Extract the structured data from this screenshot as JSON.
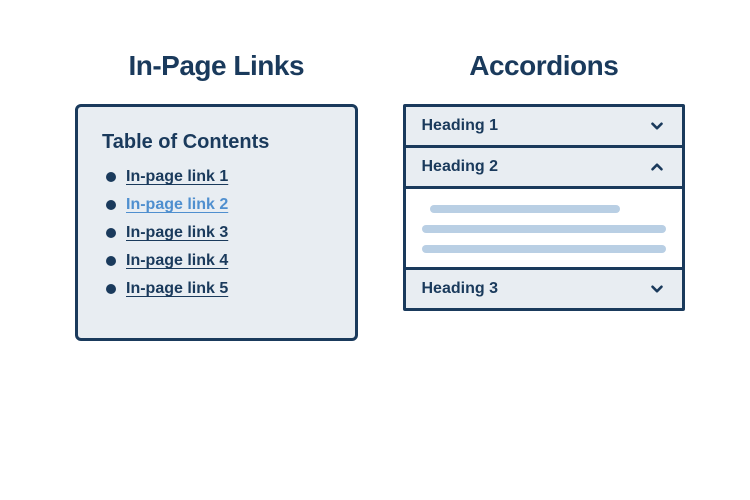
{
  "left": {
    "title": "In-Page Links",
    "toc_title": "Table of Contents",
    "links": [
      {
        "label": "In-page link 1",
        "active": false
      },
      {
        "label": "In-page link 2",
        "active": true
      },
      {
        "label": "In-page link 3",
        "active": false
      },
      {
        "label": "In-page link 4",
        "active": false
      },
      {
        "label": "In-page link 5",
        "active": false
      }
    ]
  },
  "right": {
    "title": "Accordions",
    "items": [
      {
        "label": "Heading 1",
        "expanded": false
      },
      {
        "label": "Heading 2",
        "expanded": true
      },
      {
        "label": "Heading 3",
        "expanded": false
      }
    ]
  }
}
